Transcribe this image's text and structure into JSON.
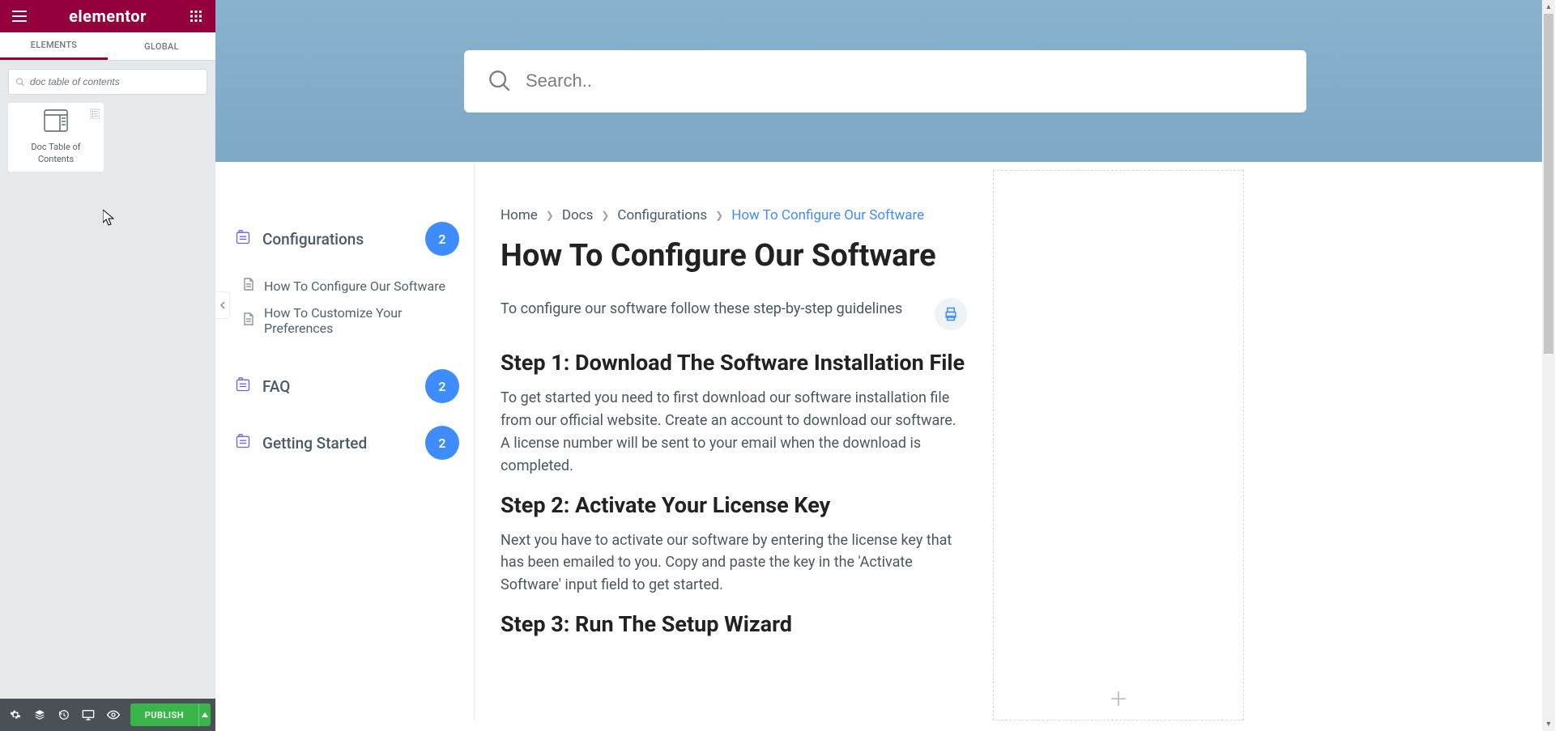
{
  "elementor": {
    "logo": "elementor",
    "tabs": {
      "elements": "ELEMENTS",
      "global": "GLOBAL"
    },
    "search_value": "doc table of contents",
    "widget_label": "Doc Table of Contents",
    "publish_label": "PUBLISH"
  },
  "hero": {
    "search_placeholder": "Search.."
  },
  "sidebar": {
    "categories": [
      {
        "label": "Configurations",
        "count": "2",
        "open": true,
        "items": [
          {
            "label": "How To Configure Our Software"
          },
          {
            "label": "How To Customize Your Preferences"
          }
        ]
      },
      {
        "label": "FAQ",
        "count": "2"
      },
      {
        "label": "Getting Started",
        "count": "2"
      }
    ]
  },
  "breadcrumb": {
    "home": "Home",
    "docs": "Docs",
    "cat": "Configurations",
    "current": "How To Configure Our Software"
  },
  "article": {
    "title": "How To Configure Our Software",
    "intro": "To configure our software follow these step-by-step guidelines",
    "step1_h": "Step 1: Download The Software Installation File",
    "step1_p": "To get started you need to first download our software installation file from our official website. Create an account to download our software. A license number will be sent to your email when the download is completed.",
    "step2_h": "Step 2: Activate Your License Key",
    "step2_p": "Next you have to activate our software by entering the license key that has been emailed to you. Copy and paste the key in the 'Activate Software' input field to get started.",
    "step3_h": "Step 3: Run The Setup Wizard"
  }
}
